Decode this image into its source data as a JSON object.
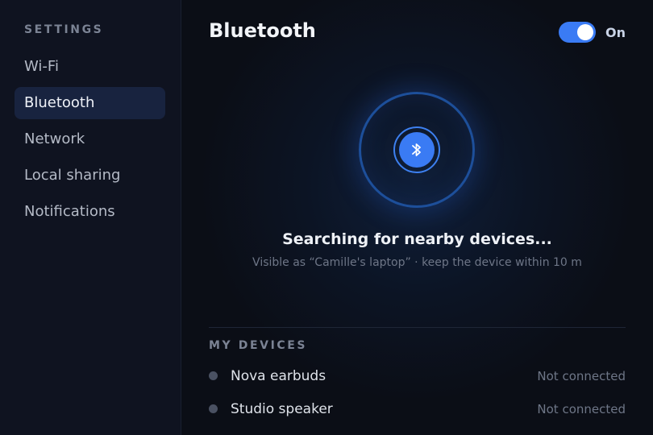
{
  "sidebar": {
    "heading": "SETTINGS",
    "items": [
      {
        "label": "Wi-Fi",
        "active": false
      },
      {
        "label": "Bluetooth",
        "active": true
      },
      {
        "label": "Network",
        "active": false
      },
      {
        "label": "Local sharing",
        "active": false
      },
      {
        "label": "Notifications",
        "active": false
      }
    ]
  },
  "header": {
    "title": "Bluetooth",
    "toggle_label": "On",
    "toggle_on": true
  },
  "scan": {
    "icon": "bluetooth-icon",
    "status": "Searching for nearby devices...",
    "subtitle": "Visible as “Camille's laptop” · keep the device within 10 m"
  },
  "devices": {
    "heading": "MY DEVICES",
    "items": [
      {
        "name": "Nova earbuds",
        "status": "Not connected"
      },
      {
        "name": "Studio speaker",
        "status": "Not connected"
      }
    ]
  },
  "colors": {
    "accent": "#3a7bf4",
    "sidebar_active_bg": "#18233f",
    "background": "#0b0e16"
  }
}
